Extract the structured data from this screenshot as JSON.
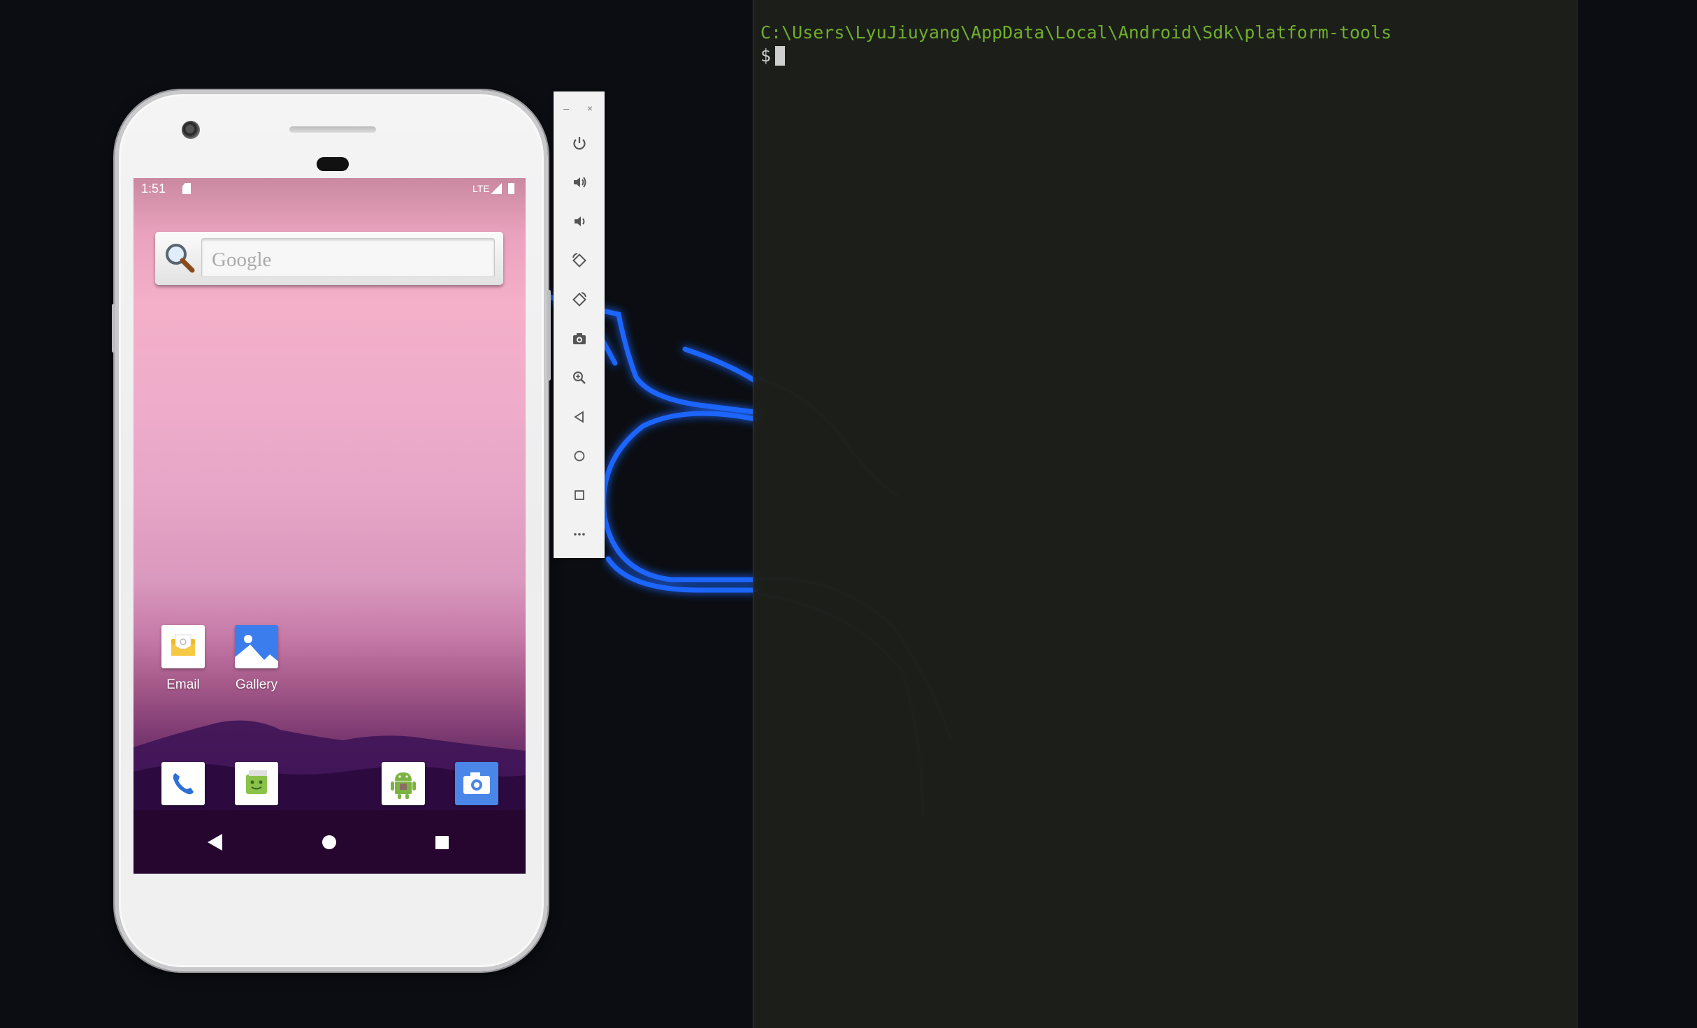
{
  "terminal": {
    "path": "C:\\Users\\LyuJiuyang\\AppData\\Local\\Android\\Sdk\\platform-tools",
    "prompt": "$"
  },
  "phone": {
    "status_bar": {
      "time": "1:51",
      "network": "LTE"
    },
    "search_widget": {
      "placeholder": "Google"
    },
    "home_apps": [
      {
        "label": "Email"
      },
      {
        "label": "Gallery"
      }
    ],
    "dock": [
      "phone-icon",
      "messenger-icon",
      "android-app-icon",
      "camera-icon"
    ],
    "nav": [
      "back-icon",
      "home-icon",
      "recents-icon"
    ]
  },
  "emulator_toolbar": {
    "window_controls": [
      "minimize-icon",
      "close-icon"
    ],
    "buttons": [
      "power-icon",
      "volume-up-icon",
      "volume-down-icon",
      "rotate-left-icon",
      "rotate-right-icon",
      "screenshot-icon",
      "zoom-icon",
      "back-icon",
      "home-icon",
      "overview-icon",
      "more-icon"
    ]
  },
  "colors": {
    "terminal_path": "#6fae2b",
    "dragon_glow": "#1a5cff",
    "camera_app": "#4a86e8"
  }
}
